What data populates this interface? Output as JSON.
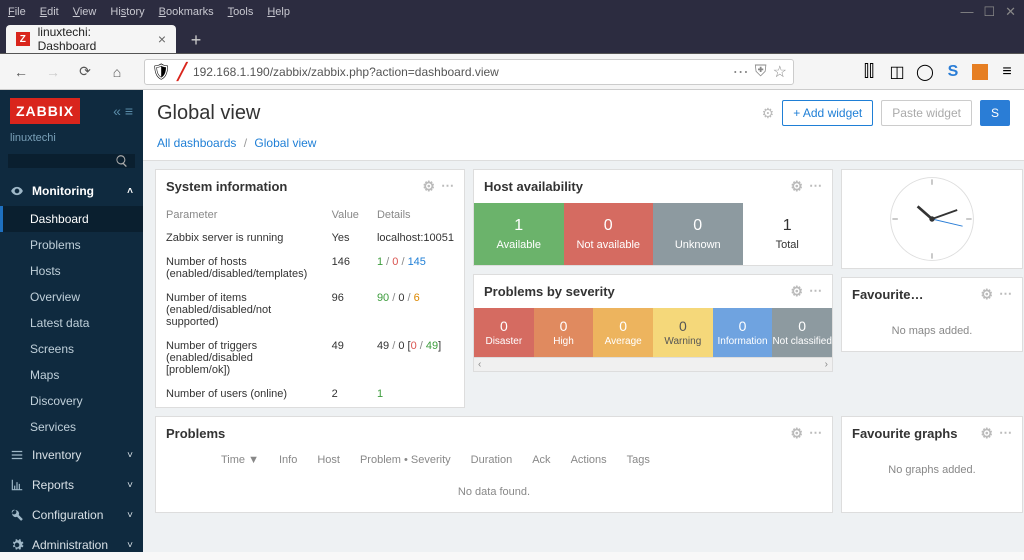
{
  "os_menu": [
    "File",
    "Edit",
    "View",
    "History",
    "Bookmarks",
    "Tools",
    "Help"
  ],
  "tab": {
    "favicon": "Z",
    "title": "linuxtechi: Dashboard"
  },
  "url": "192.168.1.190/zabbix/zabbix.php?action=dashboard.view",
  "brand": "ZABBIX",
  "user": "linuxtechi",
  "sidebar": {
    "monitoring": "Monitoring",
    "items": [
      "Dashboard",
      "Problems",
      "Hosts",
      "Overview",
      "Latest data",
      "Screens",
      "Maps",
      "Discovery",
      "Services"
    ],
    "inventory": "Inventory",
    "reports": "Reports",
    "configuration": "Configuration",
    "administration": "Administration"
  },
  "page": {
    "title": "Global view",
    "add_widget": "+ Add widget",
    "paste_widget": "Paste widget",
    "save": "S"
  },
  "breadcrumb": {
    "all": "All dashboards",
    "current": "Global view"
  },
  "sysinfo": {
    "title": "System information",
    "h_param": "Parameter",
    "h_value": "Value",
    "h_details": "Details",
    "rows": [
      {
        "p": "Zabbix server is running",
        "v": "Yes",
        "d": "localhost:10051",
        "vclass": "green"
      },
      {
        "p": "Number of hosts (enabled/disabled/templates)",
        "v": "146",
        "d": "<span class='green'>1</span> <span class='sep2'>/</span> <span class='red'>0</span> <span class='sep2'>/</span> <span class='blue2'>145</span>"
      },
      {
        "p": "Number of items (enabled/disabled/not supported)",
        "v": "96",
        "d": "<span class='green'>90</span> <span class='sep2'>/</span> 0 <span class='sep2'>/</span> <span class='orange'>6</span>"
      },
      {
        "p": "Number of triggers (enabled/disabled [problem/ok])",
        "v": "49",
        "d": "49 <span class='sep2'>/</span> 0 [<span class='red'>0</span> <span class='sep2'>/</span> <span class='green'>49</span>]"
      },
      {
        "p": "Number of users (online)",
        "v": "2",
        "d": "<span class='green'>1</span>"
      }
    ]
  },
  "avail": {
    "title": "Host availability",
    "cells": [
      {
        "n": "1",
        "l": "Available",
        "c": "c-green"
      },
      {
        "n": "0",
        "l": "Not available",
        "c": "c-red"
      },
      {
        "n": "0",
        "l": "Unknown",
        "c": "c-grey"
      },
      {
        "n": "1",
        "l": "Total",
        "c": "c-white"
      }
    ]
  },
  "sev": {
    "title": "Problems by severity",
    "cells": [
      {
        "n": "0",
        "l": "Disaster",
        "c": "s-dis"
      },
      {
        "n": "0",
        "l": "High",
        "c": "s-high"
      },
      {
        "n": "0",
        "l": "Average",
        "c": "s-avg"
      },
      {
        "n": "0",
        "l": "Warning",
        "c": "s-warn"
      },
      {
        "n": "0",
        "l": "Information",
        "c": "s-info"
      },
      {
        "n": "0",
        "l": "Not classified",
        "c": "s-nc"
      }
    ]
  },
  "problems": {
    "title": "Problems",
    "cols": [
      "Time ▼",
      "Info",
      "Host",
      "Problem • Severity",
      "Duration",
      "Ack",
      "Actions",
      "Tags"
    ],
    "empty": "No data found."
  },
  "fav_maps": {
    "title": "Favourite…",
    "empty": "No maps added."
  },
  "fav_graphs": {
    "title": "Favourite graphs",
    "empty": "No graphs added."
  }
}
